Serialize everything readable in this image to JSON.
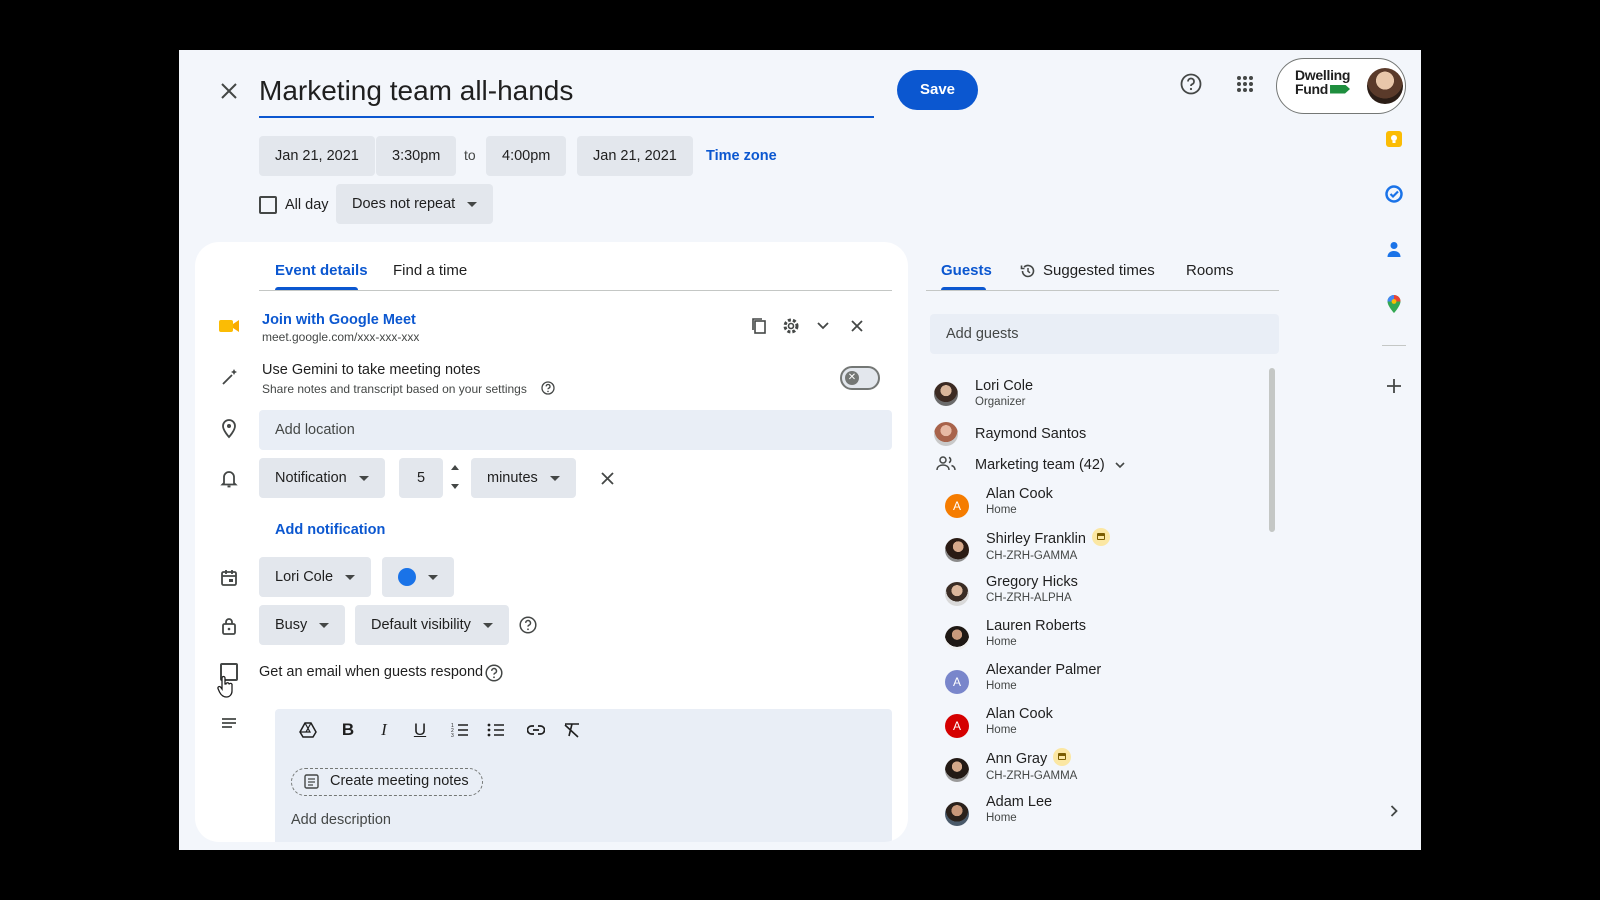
{
  "event": {
    "title": "Marketing team all-hands",
    "save_label": "Save",
    "start_date": "Jan 21, 2021",
    "start_time": "3:30pm",
    "to_label": "to",
    "end_time": "4:00pm",
    "end_date": "Jan 21, 2021",
    "timezone_label": "Time zone",
    "allday_label": "All day",
    "repeat_value": "Does not repeat"
  },
  "account": {
    "brand_line1": "Dwelling",
    "brand_line2": "Fund"
  },
  "left_tabs": [
    {
      "label": "Event details"
    },
    {
      "label": "Find a time"
    }
  ],
  "meet": {
    "title": "Join with Google Meet",
    "link": "meet.google.com/xxx-xxx-xxx"
  },
  "gemini": {
    "title": "Use Gemini to take meeting notes",
    "subtitle": "Share notes and transcript based on your settings"
  },
  "location": {
    "placeholder": "Add location"
  },
  "notification": {
    "type": "Notification",
    "amount": "5",
    "unit": "minutes",
    "add_label": "Add notification"
  },
  "calendar": {
    "owner": "Lori Cole",
    "color": "#1a73e8"
  },
  "availability": {
    "status": "Busy",
    "visibility": "Default visibility"
  },
  "email_label": "Get an email when guests respond",
  "description": {
    "notes_button": "Create meeting notes",
    "placeholder": "Add description"
  },
  "right_tabs": [
    {
      "label": "Guests"
    },
    {
      "label": "Suggested times"
    },
    {
      "label": "Rooms"
    }
  ],
  "guests_input": {
    "placeholder": "Add guests"
  },
  "organizer": {
    "name": "Lori Cole",
    "role": "Organizer"
  },
  "guest_top": {
    "name": "Raymond Santos"
  },
  "group": {
    "name": "Marketing team (42)"
  },
  "members": [
    {
      "name": "Alan Cook",
      "location": "Home",
      "avatar": "letter",
      "initial": "A",
      "color": "#f57c00"
    },
    {
      "name": "Shirley Franklin",
      "location": "CH-ZRH-GAMMA",
      "avatar": "photo",
      "badge": true
    },
    {
      "name": "Gregory Hicks",
      "location": "CH-ZRH-ALPHA",
      "avatar": "photo"
    },
    {
      "name": "Lauren Roberts",
      "location": "Home",
      "avatar": "photo"
    },
    {
      "name": "Alexander Palmer",
      "location": "Home",
      "avatar": "letter",
      "initial": "A",
      "color": "#7986cb"
    },
    {
      "name": "Alan Cook",
      "location": "Home",
      "avatar": "letter",
      "initial": "A",
      "color": "#d50000"
    },
    {
      "name": "Ann Gray",
      "location": "CH-ZRH-GAMMA",
      "avatar": "photo",
      "badge": true
    },
    {
      "name": "Adam Lee",
      "location": "Home",
      "avatar": "photo"
    }
  ],
  "colors": {
    "accent": "#0b57d0",
    "page_bg": "#f3f6fb",
    "chip_bg": "#e3e7ed"
  }
}
